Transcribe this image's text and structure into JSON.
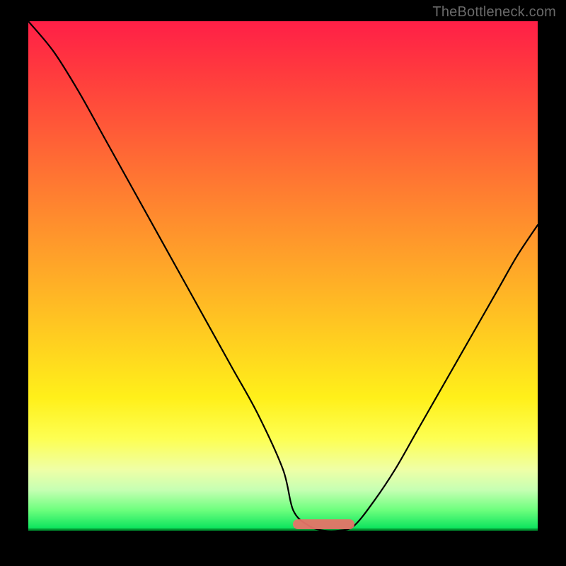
{
  "watermark": "TheBottleneck.com",
  "colors": {
    "background": "#000000",
    "watermark": "#6a6a6a",
    "curve": "#000000",
    "trough_marker": "#e57368",
    "gradient_stops": [
      "#ff1f47",
      "#ff3a3e",
      "#ff6236",
      "#ff8a2e",
      "#ffb126",
      "#ffd31f",
      "#fff01a",
      "#fdff53",
      "#efffa6",
      "#c6ffb3",
      "#6cff7d",
      "#00e05a"
    ]
  },
  "chart_data": {
    "type": "line",
    "title": "",
    "xlabel": "",
    "ylabel": "",
    "x_range": [
      0,
      100
    ],
    "y_range": [
      0,
      100
    ],
    "y_axis_inverted": false,
    "trough": {
      "x_start": 52,
      "x_end": 64,
      "y": 0
    },
    "series": [
      {
        "name": "bottleneck-curve",
        "x": [
          0,
          5,
          10,
          15,
          20,
          25,
          30,
          35,
          40,
          45,
          50,
          52,
          55,
          58,
          61,
          64,
          68,
          72,
          76,
          80,
          84,
          88,
          92,
          96,
          100
        ],
        "y": [
          100,
          94,
          86,
          77,
          68,
          59,
          50,
          41,
          32,
          23,
          12,
          4,
          1,
          0,
          0,
          1,
          6,
          12,
          19,
          26,
          33,
          40,
          47,
          54,
          60
        ]
      }
    ],
    "annotations": [
      {
        "type": "marker",
        "shape": "rounded-bar",
        "x_start": 52,
        "x_end": 64,
        "y": 0,
        "color": "#e57368"
      }
    ]
  }
}
